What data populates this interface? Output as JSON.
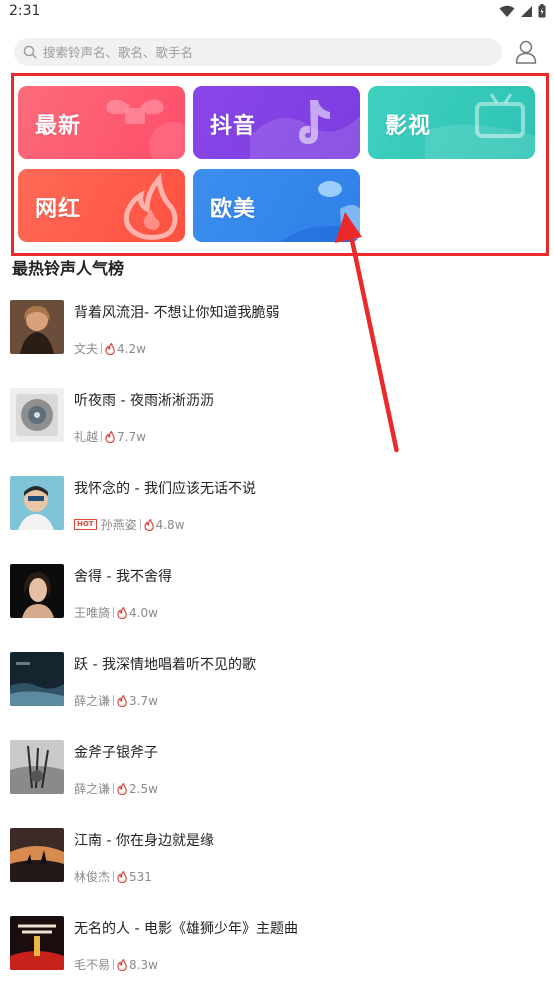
{
  "status_bar": {
    "time": "2:31"
  },
  "search": {
    "placeholder": "搜索铃声名、歌名、歌手名"
  },
  "categories": [
    {
      "label": "最新",
      "color": "#ff5a6e"
    },
    {
      "label": "抖音",
      "color": "#8342e6"
    },
    {
      "label": "影视",
      "color": "#36c9ba"
    },
    {
      "label": "网红",
      "color": "#ff5c4a"
    },
    {
      "label": "欧美",
      "color": "#3588ec"
    }
  ],
  "section_title": "最热铃声人气榜",
  "songs": [
    {
      "title": "背着风流泪- 不想让你知道我脆弱",
      "artist": "文夫",
      "plays": "4.2w",
      "hot": false
    },
    {
      "title": "听夜雨 - 夜雨淅淅沥沥",
      "artist": "礼越",
      "plays": "7.7w",
      "hot": false
    },
    {
      "title": "我怀念的 - 我们应该无话不说",
      "artist": "孙燕姿",
      "plays": "4.8w",
      "hot": true,
      "hot_label": "HOT"
    },
    {
      "title": "舍得 - 我不舍得",
      "artist": "王唯旖",
      "plays": "4.0w",
      "hot": false
    },
    {
      "title": "跃 - 我深情地唱着听不见的歌",
      "artist": "薛之谦",
      "plays": "3.7w",
      "hot": false
    },
    {
      "title": "金斧子银斧子",
      "artist": "薛之谦",
      "plays": "2.5w",
      "hot": false
    },
    {
      "title": "江南 - 你在身边就是缘",
      "artist": "林俊杰",
      "plays": "531",
      "hot": false
    },
    {
      "title": "无名的人 - 电影《雄狮少年》主题曲",
      "artist": "毛不易",
      "plays": "8.3w",
      "hot": false
    }
  ],
  "colors": {
    "accent": "#ea2a2a",
    "fire": "#e0453c"
  },
  "icons": {
    "search": "search-icon",
    "profile": "user-icon",
    "fire": "fire-icon"
  }
}
